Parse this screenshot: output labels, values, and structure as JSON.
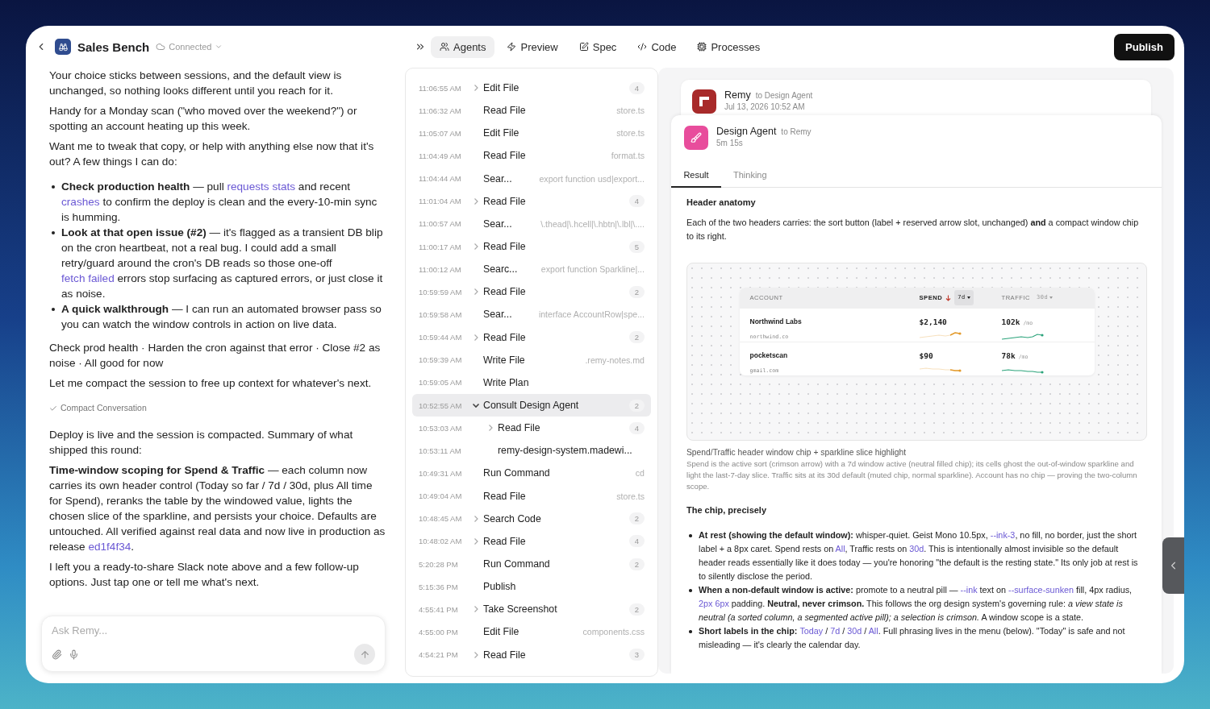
{
  "header": {
    "title": "Sales Bench",
    "status": "Connected"
  },
  "tabs": [
    {
      "label": "Agents",
      "selected": true
    },
    {
      "label": "Preview",
      "selected": false
    },
    {
      "label": "Spec",
      "selected": false
    },
    {
      "label": "Code",
      "selected": false
    },
    {
      "label": "Processes",
      "selected": false
    }
  ],
  "publish_button": "Publish",
  "chat": {
    "blocks": [
      {
        "kind": "paragraph",
        "segments": [
          {
            "kind": "plain",
            "text": "Your choice sticks between sessions, and the default view is unchanged, so nothing looks different until you reach for it."
          }
        ]
      },
      {
        "kind": "paragraph",
        "segments": [
          {
            "kind": "plain",
            "text": "Handy for a Monday scan (\"who moved over the weekend?\") or spotting an account heating up this week."
          }
        ]
      },
      {
        "kind": "paragraph",
        "segments": [
          {
            "kind": "plain",
            "text": "Want me to tweak that copy, or help with anything else now that it's out? A few things I can do:"
          }
        ]
      },
      {
        "kind": "bullets",
        "items": [
          [
            {
              "kind": "bold",
              "text": "Check production health"
            },
            {
              "kind": "plain",
              "text": " — pull "
            },
            {
              "kind": "link",
              "text": "requests stats"
            },
            {
              "kind": "plain",
              "text": " and recent "
            },
            {
              "kind": "link",
              "text": "crashes"
            },
            {
              "kind": "plain",
              "text": " to confirm the deploy is clean and the every-10-min sync is humming."
            }
          ],
          [
            {
              "kind": "bold",
              "text": "Look at that open issue (#2)"
            },
            {
              "kind": "plain",
              "text": " — it's flagged as a transient DB blip on the cron heartbeat, not a real bug. I could add a small retry/guard around the cron's DB reads so those one-off "
            },
            {
              "kind": "link",
              "text": "fetch failed"
            },
            {
              "kind": "plain",
              "text": " errors stop surfacing as captured errors, or just close it as noise."
            }
          ],
          [
            {
              "kind": "bold",
              "text": "A quick walkthrough"
            },
            {
              "kind": "plain",
              "text": " — I can run an automated browser pass so you can watch the window controls in action on live data."
            }
          ]
        ]
      },
      {
        "kind": "paragraph",
        "segments": [
          {
            "kind": "plain",
            "text": "Check prod health · Harden the cron against that error · Close #2 as noise · All good for now"
          }
        ]
      },
      {
        "kind": "paragraph",
        "segments": [
          {
            "kind": "plain",
            "text": "Let me compact the session to free up context for whatever's next."
          }
        ]
      },
      {
        "kind": "status",
        "text": "Compact Conversation"
      },
      {
        "kind": "paragraph",
        "segments": [
          {
            "kind": "plain",
            "text": "Deploy is live and the session is compacted. Summary of what shipped this round:"
          }
        ]
      },
      {
        "kind": "paragraph",
        "segments": [
          {
            "kind": "bold",
            "text": "Time-window scoping for Spend & Traffic"
          },
          {
            "kind": "plain",
            "text": " — each column now carries its own header control (Today so far / 7d / 30d, plus All time for Spend), reranks the table by the windowed value, lights the chosen slice of the sparkline, and persists your choice. Defaults are untouched. All verified against real data and now live in production as release "
          },
          {
            "kind": "link",
            "text": "ed1f4f34"
          },
          {
            "kind": "plain",
            "text": "."
          }
        ]
      },
      {
        "kind": "paragraph",
        "segments": [
          {
            "kind": "plain",
            "text": "I left you a ready-to-share Slack note above and a few follow-up options. Just tap one or tell me what's next."
          }
        ]
      }
    ],
    "input": {
      "placeholder": "Ask Remy..."
    }
  },
  "activity": [
    {
      "time": "11:06:55 AM",
      "name": "Edit File",
      "count": "4",
      "expandable": true,
      "expanded": false,
      "selected": false
    },
    {
      "time": "11:06:32 AM",
      "name": "Read File",
      "detail": "store.ts",
      "expandable": false,
      "selected": false
    },
    {
      "time": "11:05:07 AM",
      "name": "Edit File",
      "detail": "store.ts",
      "expandable": false,
      "selected": false
    },
    {
      "time": "11:04:49 AM",
      "name": "Read File",
      "detail": "format.ts",
      "expandable": false,
      "selected": false
    },
    {
      "time": "11:04:44 AM",
      "name": "Sear...",
      "detail": "export function usd|export...",
      "expandable": false,
      "selected": false
    },
    {
      "time": "11:01:04 AM",
      "name": "Read File",
      "count": "4",
      "expandable": true,
      "expanded": false,
      "selected": false
    },
    {
      "time": "11:00:57 AM",
      "name": "Sear...",
      "detail": "\\.thead|\\.hcell|\\.hbtn|\\.lbl|\\....",
      "expandable": false,
      "selected": false
    },
    {
      "time": "11:00:17 AM",
      "name": "Read File",
      "count": "5",
      "expandable": true,
      "expanded": false,
      "selected": false
    },
    {
      "time": "11:00:12 AM",
      "name": "Searc...",
      "detail": "export function Sparkline|...",
      "expandable": false,
      "selected": false
    },
    {
      "time": "10:59:59 AM",
      "name": "Read File",
      "count": "2",
      "expandable": true,
      "expanded": false,
      "selected": false
    },
    {
      "time": "10:59:58 AM",
      "name": "Sear...",
      "detail": "interface AccountRow|spe...",
      "expandable": false,
      "selected": false
    },
    {
      "time": "10:59:44 AM",
      "name": "Read File",
      "count": "2",
      "expandable": true,
      "expanded": false,
      "selected": false
    },
    {
      "time": "10:59:39 AM",
      "name": "Write File",
      "detail": ".remy-notes.md",
      "expandable": false,
      "selected": false
    },
    {
      "time": "10:59:05 AM",
      "name": "Write Plan",
      "expandable": false,
      "selected": false
    },
    {
      "time": "10:52:55 AM",
      "name": "Consult Design Agent",
      "count": "2",
      "expandable": true,
      "expanded": true,
      "selected": true,
      "children": [
        {
          "time": "10:53:03 AM",
          "name": "Read File",
          "count": "4",
          "expandable": true,
          "expanded": false,
          "selected": false
        },
        {
          "time": "10:53:11 AM",
          "name": "remy-design-system.madewi...",
          "expandable": false,
          "selected": false
        }
      ]
    },
    {
      "time": "10:49:31 AM",
      "name": "Run Command",
      "detail": "cd",
      "expandable": false,
      "selected": false
    },
    {
      "time": "10:49:04 AM",
      "name": "Read File",
      "detail": "store.ts",
      "expandable": false,
      "selected": false
    },
    {
      "time": "10:48:45 AM",
      "name": "Search Code",
      "count": "2",
      "expandable": true,
      "expanded": false,
      "selected": false
    },
    {
      "time": "10:48:02 AM",
      "name": "Read File",
      "count": "4",
      "expandable": true,
      "expanded": false,
      "selected": false
    },
    {
      "time": "5:20:28 PM",
      "name": "Run Command",
      "count": "2",
      "expandable": false,
      "selected": false
    },
    {
      "time": "5:15:36 PM",
      "name": "Publish",
      "expandable": false,
      "selected": false
    },
    {
      "time": "4:55:41 PM",
      "name": "Take Screenshot",
      "count": "2",
      "expandable": true,
      "expanded": false,
      "selected": false
    },
    {
      "time": "4:55:00 PM",
      "name": "Edit File",
      "detail": "components.css",
      "expandable": false,
      "selected": false
    },
    {
      "time": "4:54:21 PM",
      "name": "Read File",
      "count": "3",
      "expandable": true,
      "expanded": false,
      "selected": false
    }
  ],
  "detail": {
    "messages": [
      {
        "sender": "Remy",
        "to": "to Design Agent",
        "meta": "Jul 13, 2026 10:52 AM",
        "color": "#a82a2a"
      },
      {
        "sender": "Design Agent",
        "to": "to Remy",
        "meta": "5m 15s",
        "color": "#e84d9c"
      }
    ],
    "tabs": [
      {
        "label": "Result",
        "selected": true
      },
      {
        "label": "Thinking",
        "selected": false
      }
    ],
    "content": [
      {
        "kind": "heading",
        "segments": [
          {
            "kind": "plain",
            "text": "Header anatomy"
          }
        ]
      },
      {
        "kind": "paragraph",
        "segments": [
          {
            "kind": "plain",
            "text": "Each of the two headers carries: the sort button (label + reserved arrow slot, unchanged) "
          },
          {
            "kind": "bold",
            "text": "and"
          },
          {
            "kind": "plain",
            "text": " a compact window chip to its right."
          }
        ]
      },
      {
        "kind": "figure",
        "columns": [
          {
            "label": "ACCOUNT",
            "sorted": false
          },
          {
            "label": "SPEND",
            "sorted": true,
            "chip": {
              "label": "7d",
              "active": true
            }
          },
          {
            "label": "TRAFFIC",
            "sorted": false,
            "chip": {
              "label": "30d",
              "active": false
            }
          }
        ],
        "rows": [
          {
            "name": "Northwind Labs",
            "domain": "northwind.co",
            "spend": "$2,140",
            "traffic": "102k",
            "unit": "/mo"
          },
          {
            "name": "pocketscan",
            "domain": "gmail.com",
            "spend": "$90",
            "traffic": "78k",
            "unit": "/mo"
          }
        ]
      },
      {
        "kind": "caption_title",
        "segments": [
          {
            "kind": "plain",
            "text": "Spend/Traffic header window chip + sparkline slice highlight"
          }
        ]
      },
      {
        "kind": "caption",
        "segments": [
          {
            "kind": "plain",
            "text": "Spend is the active sort (crimson arrow) with a 7d window active (neutral filled chip); its cells ghost the out-of-window sparkline and light the last-7-day slice. Traffic sits at its 30d default (muted chip, normal sparkline). Account has no chip — proving the two-column scope."
          }
        ]
      },
      {
        "kind": "heading",
        "segments": [
          {
            "kind": "plain",
            "text": "The chip, precisely"
          }
        ]
      },
      {
        "kind": "bullets",
        "items": [
          [
            {
              "kind": "bold",
              "text": "At rest (showing the default window):"
            },
            {
              "kind": "plain",
              "text": " whisper-quiet. Geist Mono 10.5px, "
            },
            {
              "kind": "link",
              "text": "--ink-3"
            },
            {
              "kind": "plain",
              "text": ", no fill, no border, just the short label + a 8px caret. Spend rests on "
            },
            {
              "kind": "link",
              "text": "All"
            },
            {
              "kind": "plain",
              "text": ", Traffic rests on "
            },
            {
              "kind": "link",
              "text": "30d"
            },
            {
              "kind": "plain",
              "text": ". This is intentionally almost invisible so the default header reads essentially like it does today — you're honoring \"the default is the resting state.\" Its only job at rest is to silently disclose the period."
            }
          ],
          [
            {
              "kind": "bold",
              "text": "When a non-default window is active:"
            },
            {
              "kind": "plain",
              "text": " promote to a neutral pill — "
            },
            {
              "kind": "link",
              "text": "--ink"
            },
            {
              "kind": "plain",
              "text": " text on "
            },
            {
              "kind": "link",
              "text": "--surface-sunken"
            },
            {
              "kind": "plain",
              "text": " fill, 4px radius, "
            },
            {
              "kind": "link",
              "text": "2px 6px"
            },
            {
              "kind": "plain",
              "text": " padding. "
            },
            {
              "kind": "bold",
              "text": "Neutral, never crimson."
            },
            {
              "kind": "plain",
              "text": " This follows the org design system's governing rule: "
            },
            {
              "kind": "italic",
              "text": "a view state is neutral (a sorted column, a segmented active pill); a selection is crimson."
            },
            {
              "kind": "plain",
              "text": " A window scope is a state."
            }
          ],
          [
            {
              "kind": "bold",
              "text": "Short labels in the chip: "
            },
            {
              "kind": "link",
              "text": "Today"
            },
            {
              "kind": "plain",
              "text": " / "
            },
            {
              "kind": "link",
              "text": "7d"
            },
            {
              "kind": "plain",
              "text": " / "
            },
            {
              "kind": "link",
              "text": "30d"
            },
            {
              "kind": "plain",
              "text": " / "
            },
            {
              "kind": "link",
              "text": "All"
            },
            {
              "kind": "plain",
              "text": ". Full phrasing lives in the menu (below). \"Today\" is safe and not misleading — it's clearly the calendar day."
            }
          ]
        ]
      }
    ]
  }
}
